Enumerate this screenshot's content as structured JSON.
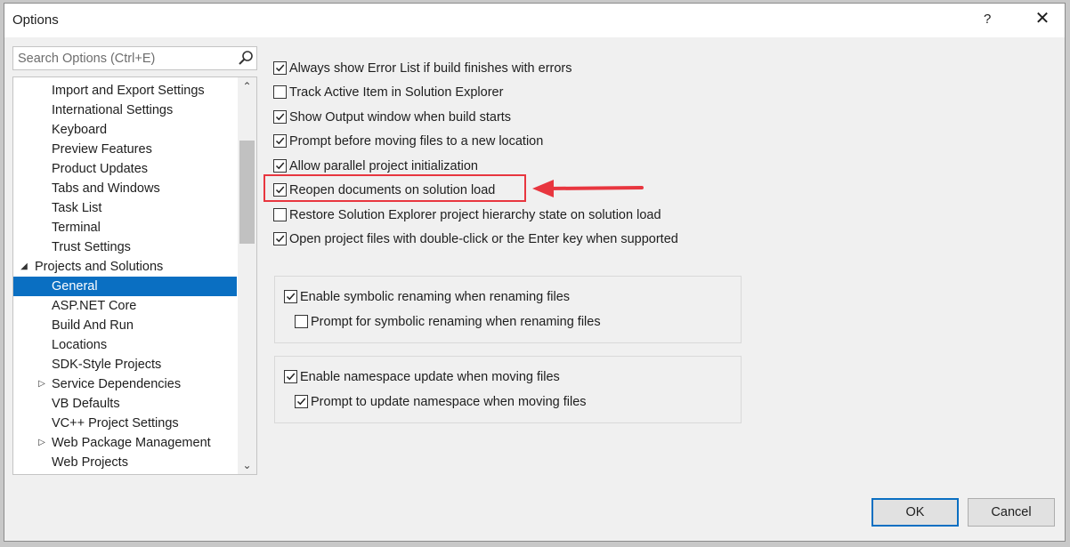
{
  "window": {
    "title": "Options",
    "help": "?",
    "close": "✕"
  },
  "search": {
    "placeholder": "Search Options (Ctrl+E)"
  },
  "tree": {
    "items": [
      {
        "label": "Import and Export Settings"
      },
      {
        "label": "International Settings"
      },
      {
        "label": "Keyboard"
      },
      {
        "label": "Preview Features"
      },
      {
        "label": "Product Updates"
      },
      {
        "label": "Tabs and Windows"
      },
      {
        "label": "Task List"
      },
      {
        "label": "Terminal"
      },
      {
        "label": "Trust Settings"
      },
      {
        "label": "Projects and Solutions",
        "expander": "expanded"
      },
      {
        "label": "General",
        "selected": true
      },
      {
        "label": "ASP.NET Core"
      },
      {
        "label": "Build And Run"
      },
      {
        "label": "Locations"
      },
      {
        "label": "SDK-Style Projects"
      },
      {
        "label": "Service Dependencies",
        "expander": "collapsed"
      },
      {
        "label": "VB Defaults"
      },
      {
        "label": "VC++ Project Settings"
      },
      {
        "label": "Web Package Management",
        "expander": "collapsed"
      },
      {
        "label": "Web Projects"
      }
    ]
  },
  "options": [
    {
      "label": "Always show Error List if build finishes with errors",
      "checked": true
    },
    {
      "label": "Track Active Item in Solution Explorer",
      "checked": false
    },
    {
      "label": "Show Output window when build starts",
      "checked": true
    },
    {
      "label": "Prompt before moving files to a new location",
      "checked": true
    },
    {
      "label": "Allow parallel project initialization",
      "checked": true
    },
    {
      "label": "Reopen documents on solution load",
      "checked": true
    },
    {
      "label": "Restore Solution Explorer project hierarchy state on solution load",
      "checked": false
    },
    {
      "label": "Open project files with double-click or the Enter key when supported",
      "checked": true
    }
  ],
  "groups": [
    {
      "main": {
        "label": "Enable symbolic renaming when renaming files",
        "checked": true
      },
      "sub": {
        "label": "Prompt for symbolic renaming when renaming files",
        "checked": false
      }
    },
    {
      "main": {
        "label": "Enable namespace update when moving files",
        "checked": true
      },
      "sub": {
        "label": "Prompt to update namespace when moving files",
        "checked": true
      }
    }
  ],
  "buttons": {
    "ok": "OK",
    "cancel": "Cancel"
  },
  "colors": {
    "selection": "#0a6fc2",
    "annotation": "#e8363f"
  }
}
